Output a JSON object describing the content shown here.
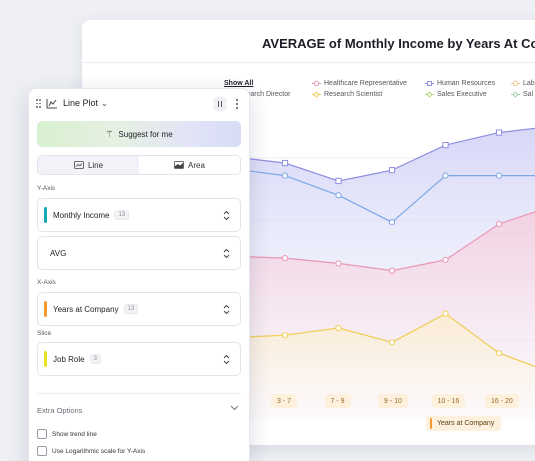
{
  "chart_card": {
    "title": "AVERAGE of Monthly Income by Years At Compa",
    "legend": {
      "show_all": "Show All",
      "items": [
        {
          "label": "Healthcare Representative",
          "color": "#e996b6",
          "marker": "circle"
        },
        {
          "label": "Human Resources",
          "color": "#8f8fe0",
          "marker": "square"
        },
        {
          "label": "Lab",
          "color": "#eec98c",
          "marker": "circle"
        },
        {
          "label": "search Director",
          "color": "#7aa8e6",
          "marker": "none"
        },
        {
          "label": "Research Scientist",
          "color": "#f0cd55",
          "marker": "diamond"
        },
        {
          "label": "Sales Executive",
          "color": "#b6d27a",
          "marker": "diamond"
        },
        {
          "label": "Sal",
          "color": "#9ad3a8",
          "marker": "diamond"
        }
      ]
    },
    "x_axis_title": "Years at Company"
  },
  "chart_data": {
    "type": "area",
    "categories": [
      "3-7",
      "7-9",
      "9-10",
      "10-16",
      "16-20"
    ],
    "series": [
      {
        "name": "Human Resources",
        "color": "#8f8fe0",
        "marker": "square",
        "values": [
          0.76,
          0.66,
          0.72,
          0.86,
          0.93
        ]
      },
      {
        "name": "Research Director",
        "color": "#7aa8e6",
        "marker": "circle",
        "values": [
          0.69,
          0.58,
          0.43,
          0.69,
          0.69
        ]
      },
      {
        "name": "Healthcare Representative",
        "color": "#e996b6",
        "marker": "circle",
        "values": [
          0.23,
          0.2,
          0.16,
          0.22,
          0.42
        ]
      },
      {
        "name": "Research Scientist",
        "color": "#f0cd55",
        "marker": "circle",
        "values": [
          -0.2,
          -0.16,
          -0.24,
          -0.08,
          -0.3
        ]
      }
    ]
  },
  "panel": {
    "title": "Line Plot",
    "suggest_label": "Suggest for me",
    "modes": {
      "line": "Line",
      "area": "Area"
    },
    "y_axis": {
      "label": "Y-Axis",
      "field": "Monthly Income",
      "count": "13",
      "color": "#16a9b8",
      "aggregation": "AVG"
    },
    "x_axis": {
      "label": "X-Axis",
      "field": "Years at Company",
      "count": "13",
      "color": "#f29a2e"
    },
    "slice": {
      "label": "Slice",
      "field": "Job Role",
      "count": "3",
      "color": "#e8e21f"
    },
    "extra": {
      "label": "Extra Options",
      "show_trend": "Show trend line",
      "log_scale": "Use Logarithmic scale for Y-Axis"
    }
  }
}
